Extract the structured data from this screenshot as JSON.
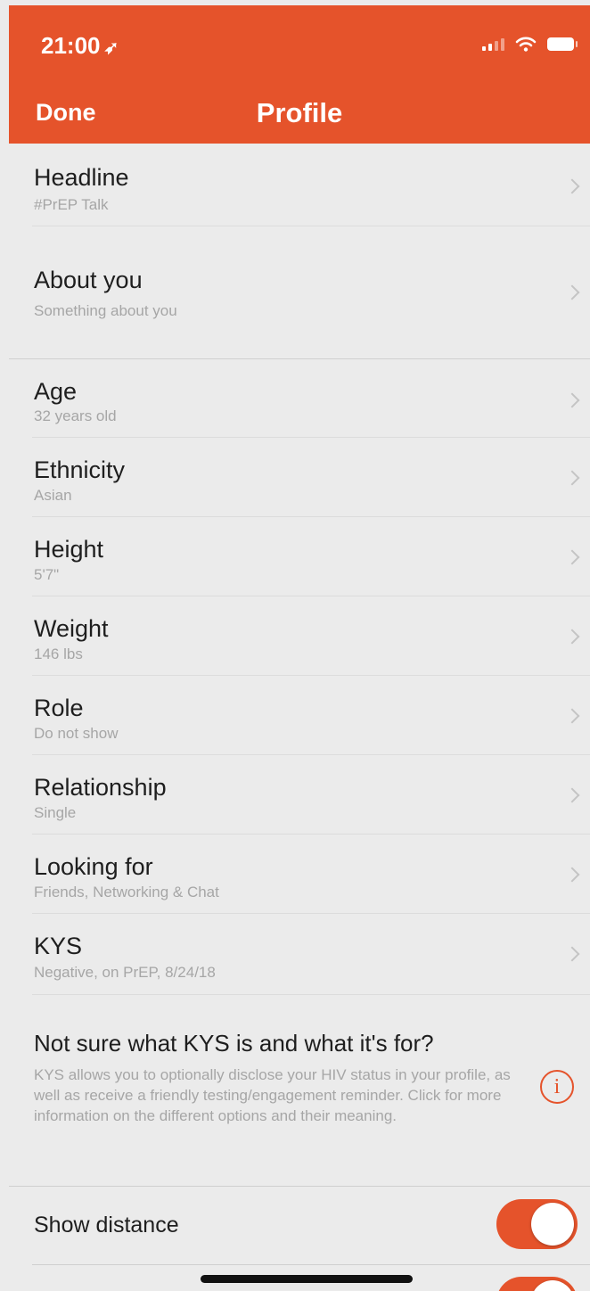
{
  "status_bar": {
    "time": "21:00",
    "location_glyph": "➶"
  },
  "nav": {
    "done_label": "Done",
    "title": "Profile"
  },
  "rows": {
    "headline": {
      "label": "Headline",
      "value": "#PrEP Talk"
    },
    "about": {
      "label": "About you",
      "value": "Something about you"
    },
    "age": {
      "label": "Age",
      "value": "32 years old"
    },
    "ethnicity": {
      "label": "Ethnicity",
      "value": "Asian"
    },
    "height": {
      "label": "Height",
      "value": "5'7\""
    },
    "weight": {
      "label": "Weight",
      "value": "146 lbs"
    },
    "role": {
      "label": "Role",
      "value": "Do not show"
    },
    "relationship": {
      "label": "Relationship",
      "value": "Single"
    },
    "looking_for": {
      "label": "Looking for",
      "value": "Friends, Networking & Chat"
    },
    "kys": {
      "label": "KYS",
      "value": "Negative, on PrEP, 8/24/18"
    }
  },
  "kys_info": {
    "question": "Not sure what KYS is and what it's for?",
    "description": "KYS allows you to optionally disclose your HIV status in your profile, as well as receive a friendly testing/engagement reminder. Click for more information on the different options and their meaning.",
    "icon_glyph": "i"
  },
  "toggles": {
    "show_distance": {
      "label": "Show distance",
      "on": true
    },
    "second": {
      "on": true
    }
  },
  "colors": {
    "accent": "#e5532b",
    "background": "#ebebeb"
  }
}
